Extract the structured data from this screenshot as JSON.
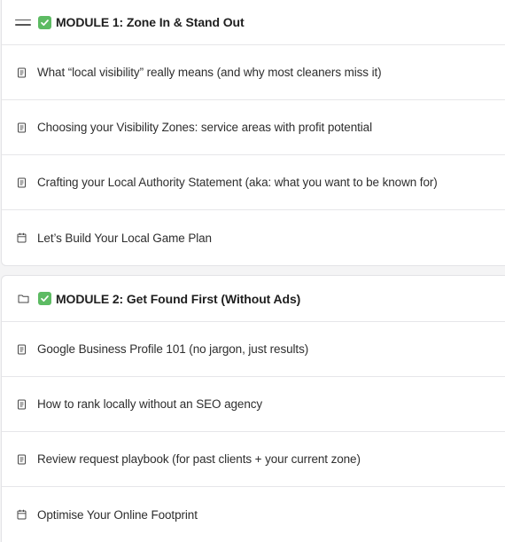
{
  "modules": [
    {
      "title": "MODULE 1: Zone In & Stand Out",
      "header_icon": "drag-handle-icon",
      "status_icon": "checkmark-icon",
      "lessons": [
        {
          "label": "What “local visibility” really means (and why most cleaners miss it)",
          "icon": "document-icon"
        },
        {
          "label": "Choosing your Visibility Zones: service areas with profit potential",
          "icon": "document-icon"
        },
        {
          "label": "Crafting your Local Authority Statement (aka: what you want to be known for)",
          "icon": "document-icon"
        },
        {
          "label": "Let’s Build Your Local Game Plan",
          "icon": "calendar-icon"
        }
      ]
    },
    {
      "title": "MODULE 2: Get Found First (Without Ads)",
      "header_icon": "folder-icon",
      "status_icon": "checkmark-icon",
      "lessons": [
        {
          "label": "Google Business Profile 101 (no jargon, just results)",
          "icon": "document-icon"
        },
        {
          "label": "How to rank locally without an SEO agency",
          "icon": "document-icon"
        },
        {
          "label": "Review request playbook (for past clients + your current zone)",
          "icon": "document-icon"
        },
        {
          "label": "Optimise Your Online Footprint",
          "icon": "calendar-icon"
        }
      ]
    }
  ],
  "colors": {
    "check_green": "#5dbb63",
    "border": "#e3e3e6",
    "text": "#2e2e2e"
  }
}
